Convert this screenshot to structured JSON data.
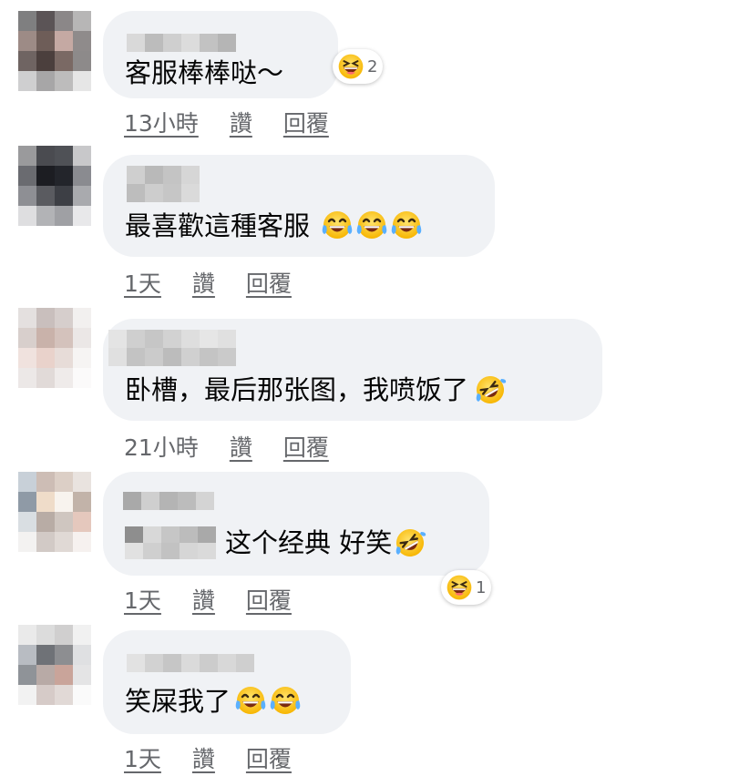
{
  "comments": [
    {
      "text": "客服棒棒哒～",
      "time": "13小時",
      "like": "讚",
      "reply": "回覆",
      "reaction_count": "2"
    },
    {
      "text": "最喜歡這種客服",
      "time": "1天",
      "like": "讚",
      "reply": "回覆"
    },
    {
      "text": "卧槽，最后那张图，我喷饭了",
      "time": "21小時",
      "like": "讚",
      "reply": "回覆"
    },
    {
      "text": "这个经典 好笑",
      "time": "1天",
      "like": "讚",
      "reply": "回覆",
      "reaction_count": "1"
    },
    {
      "text": "笑屎我了",
      "time": "1天",
      "like": "讚",
      "reply": "回覆"
    }
  ],
  "colors": {
    "bubble": "#f0f2f5",
    "meta_text": "#65676b",
    "emoji_yellow": "#ffcc33"
  },
  "icons": [
    "laughing-squint-emoji-icon",
    "tears-of-joy-emoji-icon",
    "rolling-on-floor-laughing-emoji-icon"
  ]
}
